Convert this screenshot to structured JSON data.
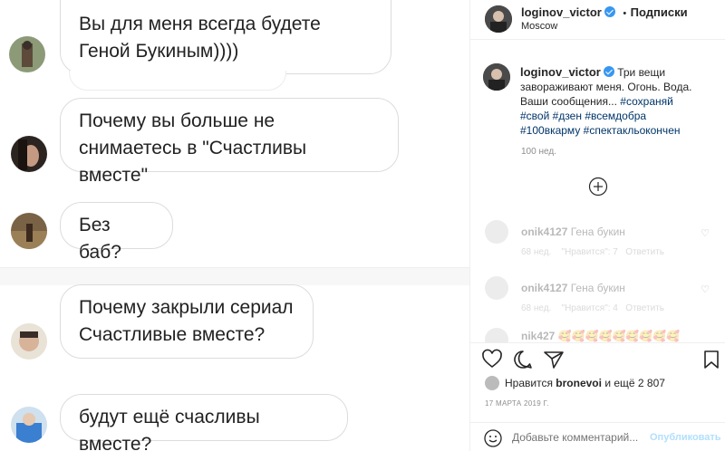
{
  "chat": [
    {
      "text": "Вы для меня всегда будете Геной Букиным))))"
    },
    {
      "text": "Почему вы больше не снимаетесь в \"Счастливы вместе\""
    },
    {
      "text": "Без баб?"
    },
    {
      "text": "Почему закрыли сериал Счастливые вместе?"
    },
    {
      "text": "будут ещё счасливы вместе?"
    }
  ],
  "header": {
    "username": "loginov_victor",
    "separator": "•",
    "follow_label": "Подписки",
    "location": "Moscow"
  },
  "post": {
    "username": "loginov_victor",
    "caption": "Три вещи завораживают меня. Огонь. Вода. Ваши сообщения...",
    "hashtags": [
      "#сохраняй",
      "#свой",
      "#дзен",
      "#всемдобра",
      "#100вкарму",
      "#спектакльокончен"
    ],
    "age": "100 нед."
  },
  "comments": [
    {
      "user": "onik4127",
      "text": "Гена букин",
      "age": "68 нед.",
      "likes": "\"Нравится\": 7",
      "reply": "Ответить"
    },
    {
      "user": "onik4127",
      "text": "Гена букин",
      "age": "68 нед.",
      "likes": "\"Нравится\": 4",
      "reply": "Ответить"
    },
    {
      "user": "nik427",
      "text": "🥰🥰🥰🥰🥰🥰🥰🥰🥰",
      "age": "",
      "likes": "",
      "reply": ""
    }
  ],
  "likes": {
    "prefix": "Нравится",
    "user": "bronevoi",
    "suffix": "и ещё 2 807"
  },
  "date": "17 МАРТА 2019 Г.",
  "add_comment": {
    "placeholder": "Добавьте комментарий...",
    "publish": "Опубликовать"
  },
  "icons": [
    "verified-icon",
    "add-comment-plus-icon",
    "heart-icon",
    "comment-icon",
    "share-icon",
    "bookmark-icon",
    "emoji-icon"
  ],
  "colors": {
    "link": "#003569",
    "verified": "#3897f0",
    "muted": "#8e8e8e"
  }
}
